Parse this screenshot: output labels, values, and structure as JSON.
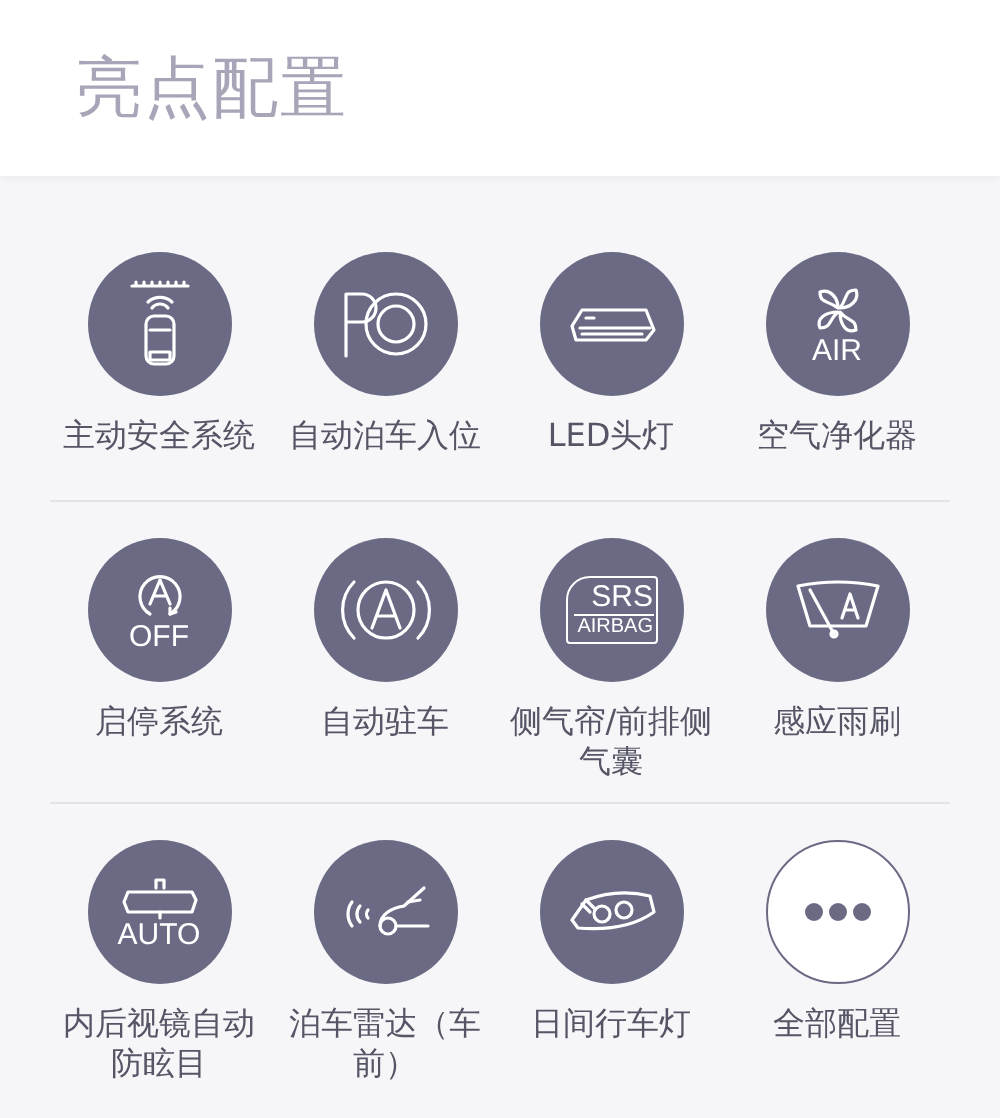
{
  "header": {
    "title": "亮点配置"
  },
  "rows": [
    {
      "items": [
        {
          "kind": "safety",
          "label": "主动安全系统"
        },
        {
          "kind": "parking",
          "label": "自动泊车入位"
        },
        {
          "kind": "led",
          "label": "LED头灯"
        },
        {
          "kind": "air",
          "icon_text": "AIR",
          "label": "空气净化器"
        }
      ]
    },
    {
      "items": [
        {
          "kind": "startstop",
          "icon_text": "OFF",
          "label": "启停系统"
        },
        {
          "kind": "autohold",
          "label": "自动驻车"
        },
        {
          "kind": "airbag",
          "icon_text": "SRS",
          "icon_subtext": "AIRBAG",
          "label": "侧气帘/前排侧气囊"
        },
        {
          "kind": "wiper",
          "label": "感应雨刷"
        }
      ]
    },
    {
      "items": [
        {
          "kind": "mirror",
          "icon_text": "AUTO",
          "label": "内后视镜自动防眩目"
        },
        {
          "kind": "radar",
          "label": "泊车雷达（车前）"
        },
        {
          "kind": "drl",
          "label": "日间行车灯"
        },
        {
          "kind": "more",
          "label": "全部配置"
        }
      ]
    }
  ]
}
